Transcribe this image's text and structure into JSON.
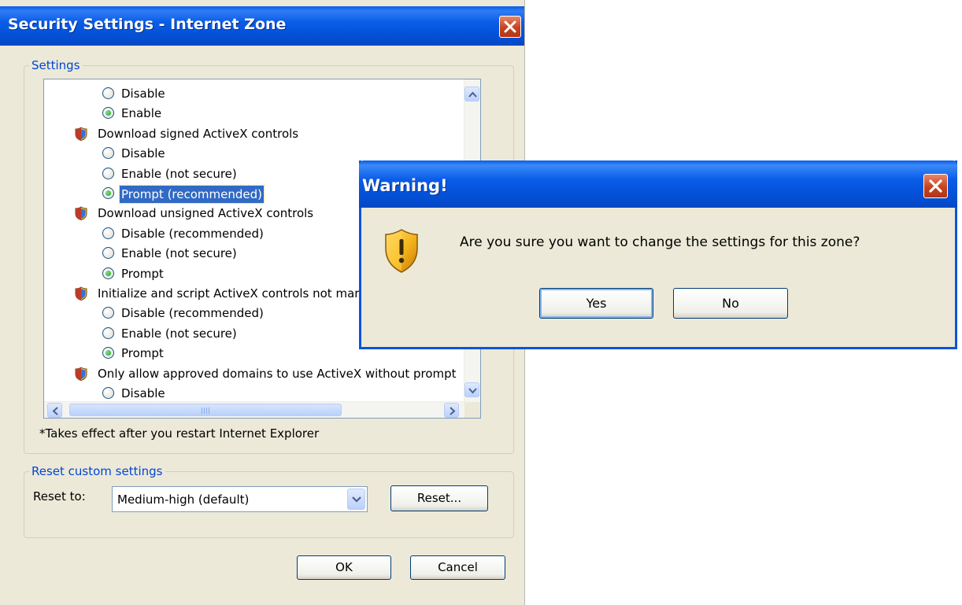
{
  "security_window": {
    "title": "Security Settings - Internet Zone",
    "settings_group_label": "Settings",
    "items": [
      {
        "type": "option",
        "label": "Disable",
        "checked": false
      },
      {
        "type": "option",
        "label": "Enable",
        "checked": true
      },
      {
        "type": "category",
        "label": "Download signed ActiveX controls"
      },
      {
        "type": "option",
        "label": "Disable",
        "checked": false
      },
      {
        "type": "option",
        "label": "Enable (not secure)",
        "checked": false
      },
      {
        "type": "option",
        "label": "Prompt (recommended)",
        "checked": true,
        "selected": true
      },
      {
        "type": "category",
        "label": "Download unsigned ActiveX controls"
      },
      {
        "type": "option",
        "label": "Disable (recommended)",
        "checked": false
      },
      {
        "type": "option",
        "label": "Enable (not secure)",
        "checked": false
      },
      {
        "type": "option",
        "label": "Prompt",
        "checked": true
      },
      {
        "type": "category",
        "label": "Initialize and script ActiveX controls not mar"
      },
      {
        "type": "option",
        "label": "Disable (recommended)",
        "checked": false
      },
      {
        "type": "option",
        "label": "Enable (not secure)",
        "checked": false
      },
      {
        "type": "option",
        "label": "Prompt",
        "checked": true
      },
      {
        "type": "category",
        "label": "Only allow approved domains to use ActiveX without prompt"
      },
      {
        "type": "option",
        "label": "Disable",
        "checked": false
      }
    ],
    "restart_note": "*Takes effect after you restart Internet Explorer",
    "reset_group_label": "Reset custom settings",
    "reset_to_label": "Reset to:",
    "reset_level_value": "Medium-high (default)",
    "reset_button": "Reset...",
    "ok_button": "OK",
    "cancel_button": "Cancel"
  },
  "warning_dialog": {
    "title": "Warning!",
    "message": "Are you sure you want to change the settings for this zone?",
    "yes_button": "Yes",
    "no_button": "No"
  },
  "colors": {
    "titlebar_blue": "#0a5ce8",
    "window_face": "#ece9d8",
    "selection_blue": "#316ac5",
    "group_label_blue": "#0046d5",
    "close_red": "#c6431f"
  }
}
